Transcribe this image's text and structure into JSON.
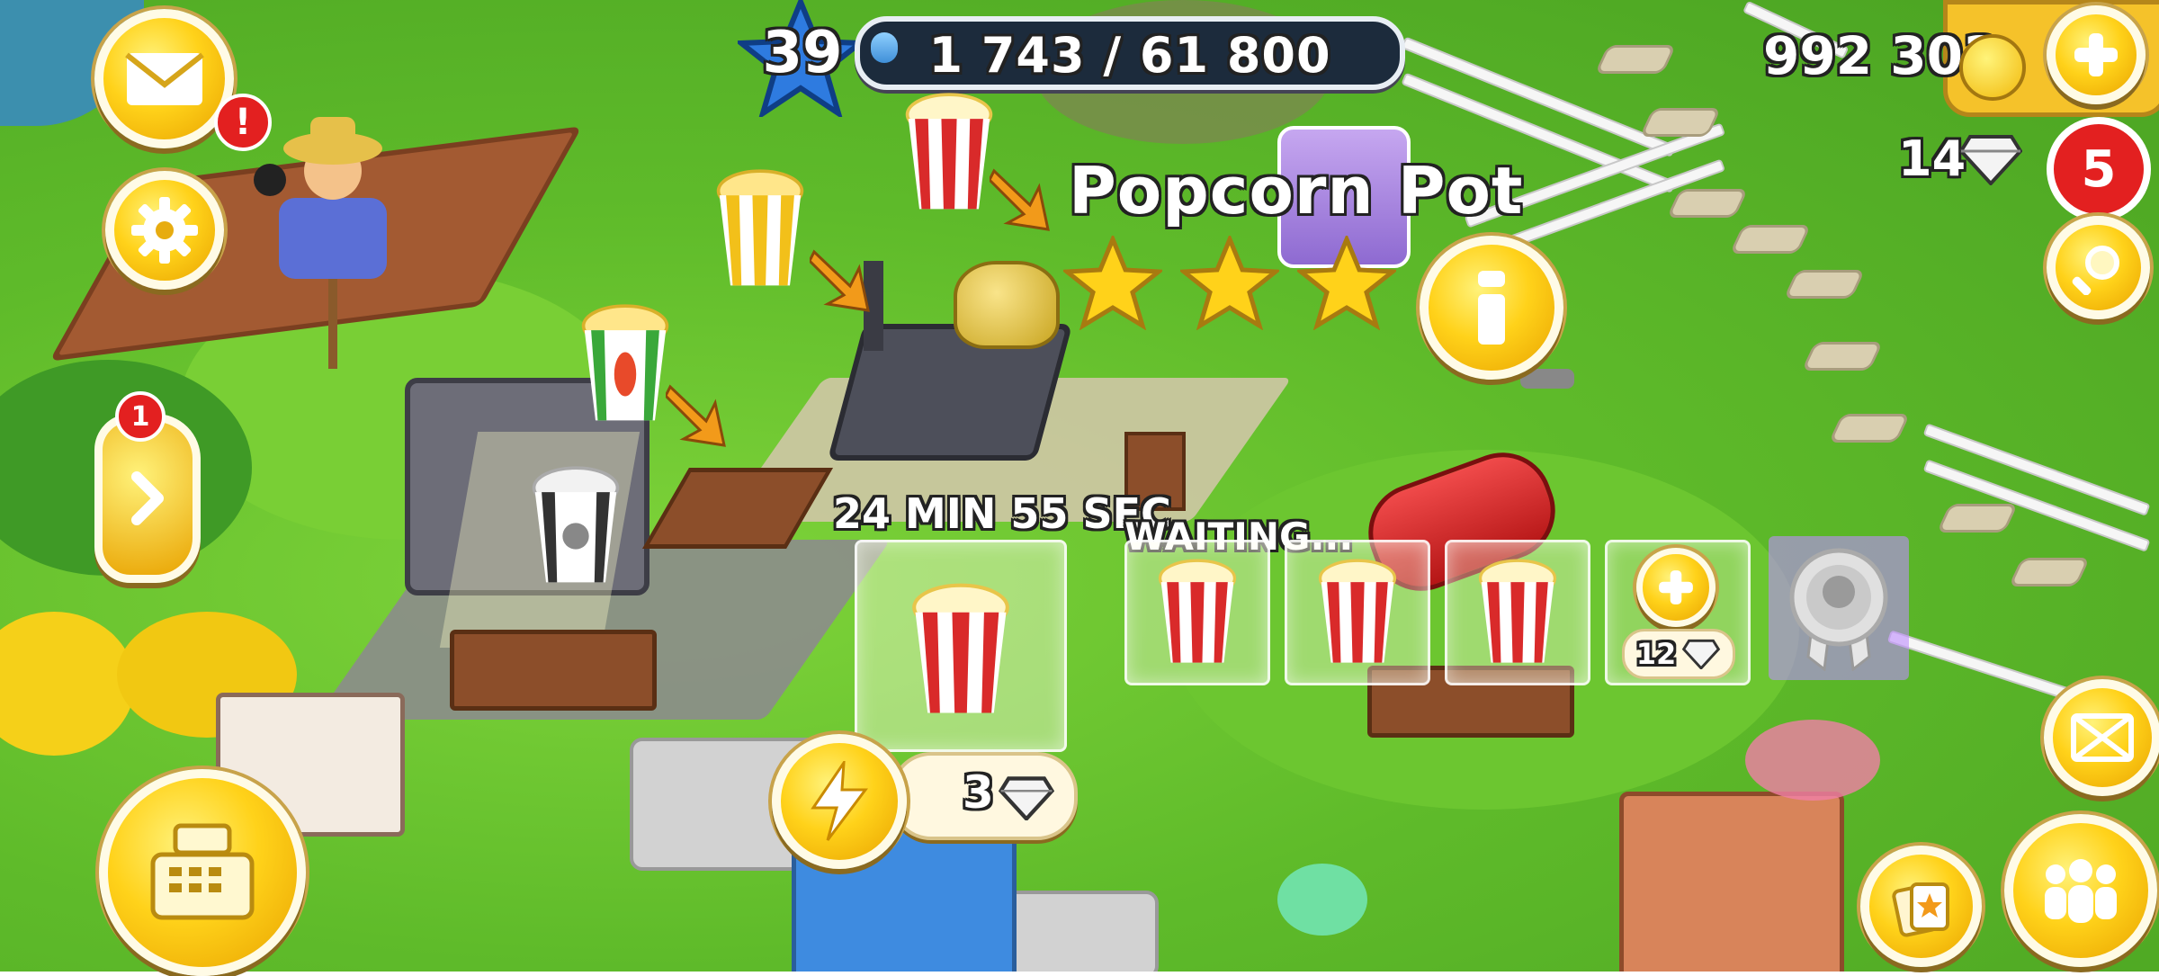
{
  "hud": {
    "level": "39",
    "xp_text": "1 743 / 61 800",
    "xp_fraction": 0.028,
    "coins": "992 303",
    "diamonds": "14",
    "notification_count": "5",
    "mail_alert": "!",
    "side_panel_badge": "1"
  },
  "production": {
    "machine_name": "Popcorn Pot",
    "star_rating": 3,
    "timer": "24 MIN 55 SEC",
    "waiting_label": "WAITING...",
    "speedup_cost": "3",
    "add_slot_cost": "12"
  },
  "icons": {
    "mail": "envelope-icon",
    "settings": "gear-icon",
    "expand": "chevron-right-icon",
    "shop": "cash-register-icon",
    "speedup": "lightning-icon",
    "add": "plus-icon",
    "search": "magnifier-icon",
    "info": "info-icon",
    "friends": "people-icon",
    "cards": "cards-icon",
    "zoom": "arrows-expand-icon",
    "achievement": "ribbon-medal-icon"
  },
  "colors": {
    "gold": "#ffd21a",
    "red": "#e32020",
    "grass": "#5fbb2a"
  }
}
